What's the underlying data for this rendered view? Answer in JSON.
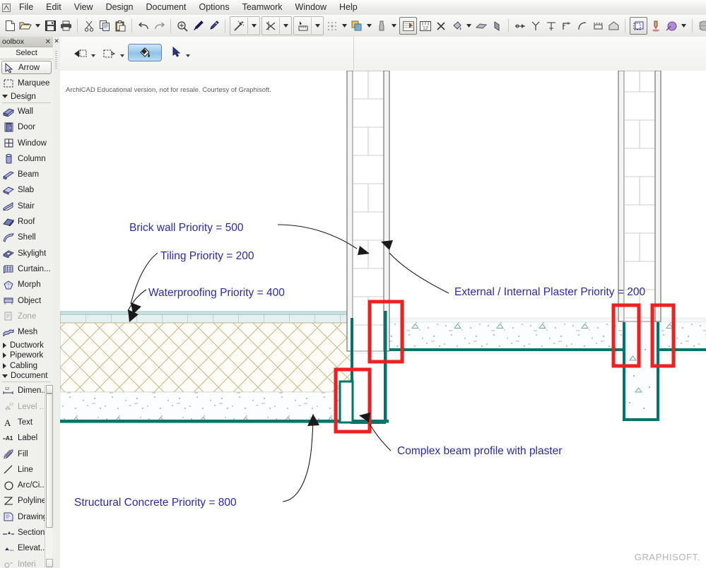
{
  "app": {
    "title": "ArchiCAD",
    "watermark": "GRAPHISOFT.",
    "edu_note": "ArchiCAD Educational version, not for resale. Courtesy of Graphisoft."
  },
  "menubar": {
    "logo_icon": "archicad-app-icon",
    "items": [
      {
        "label": "File"
      },
      {
        "label": "Edit"
      },
      {
        "label": "View"
      },
      {
        "label": "Design"
      },
      {
        "label": "Document"
      },
      {
        "label": "Options"
      },
      {
        "label": "Teamwork"
      },
      {
        "label": "Window"
      },
      {
        "label": "Help"
      }
    ]
  },
  "toolbar": {
    "items": [
      {
        "name": "new-file-icon",
        "kind": "icon"
      },
      {
        "name": "open-file-icon",
        "kind": "icon"
      },
      {
        "name": "open-file-dropdown",
        "kind": "caret"
      },
      {
        "name": "save-icon",
        "kind": "icon"
      },
      {
        "name": "print-icon",
        "kind": "icon"
      },
      {
        "name": "separator",
        "kind": "sep"
      },
      {
        "name": "cut-icon",
        "kind": "icon"
      },
      {
        "name": "copy-icon",
        "kind": "icon"
      },
      {
        "name": "paste-icon",
        "kind": "icon"
      },
      {
        "name": "separator",
        "kind": "sep"
      },
      {
        "name": "undo-icon",
        "kind": "icon"
      },
      {
        "name": "redo-icon",
        "kind": "icon"
      },
      {
        "name": "separator",
        "kind": "sep"
      },
      {
        "name": "zoom-window-icon",
        "kind": "icon"
      },
      {
        "name": "eyedropper-pick-icon",
        "kind": "icon"
      },
      {
        "name": "eyedropper-inject-icon",
        "kind": "icon"
      },
      {
        "name": "separator",
        "kind": "sep"
      },
      {
        "name": "magic-wand-icon",
        "kind": "group-icon"
      },
      {
        "name": "magic-wand-dropdown",
        "kind": "group-caret"
      },
      {
        "name": "trim-icon",
        "kind": "group-icon"
      },
      {
        "name": "trim-dropdown",
        "kind": "group-caret"
      },
      {
        "name": "measure-icon",
        "kind": "group-icon"
      },
      {
        "name": "measure-dropdown",
        "kind": "group-caret"
      },
      {
        "name": "grid-snap-icon",
        "kind": "icon"
      },
      {
        "name": "grid-snap-dropdown",
        "kind": "caret"
      },
      {
        "name": "layers-icon",
        "kind": "icon"
      },
      {
        "name": "layers-dropdown",
        "kind": "caret"
      },
      {
        "name": "pen-weight-icon",
        "kind": "icon"
      },
      {
        "name": "pen-weight-dropdown",
        "kind": "caret"
      },
      {
        "name": "build-material-icon",
        "kind": "boxed"
      },
      {
        "name": "dimension-settings-icon",
        "kind": "icon"
      },
      {
        "name": "scissors-icon",
        "kind": "icon"
      },
      {
        "name": "fill-pour-icon",
        "kind": "icon"
      },
      {
        "name": "fill-pour-dropdown",
        "kind": "caret"
      },
      {
        "name": "surface-paint-icon",
        "kind": "icon"
      },
      {
        "name": "surface-flip-icon",
        "kind": "icon"
      },
      {
        "name": "separator",
        "kind": "sep"
      },
      {
        "name": "connect-icon",
        "kind": "icon"
      },
      {
        "name": "split-icon",
        "kind": "icon"
      },
      {
        "name": "adjust-icon",
        "kind": "icon"
      },
      {
        "name": "intersect-icon",
        "kind": "icon"
      },
      {
        "name": "curve-fillet-icon",
        "kind": "icon"
      },
      {
        "name": "offset-icon",
        "kind": "icon"
      },
      {
        "name": "solid-ops-icon",
        "kind": "icon"
      },
      {
        "name": "separator",
        "kind": "sep"
      },
      {
        "name": "marquee-3d-icon",
        "kind": "boxed"
      },
      {
        "name": "3d-cutaway-icon",
        "kind": "icon"
      },
      {
        "name": "renovation-icon",
        "kind": "icon"
      },
      {
        "name": "renovation-dropdown",
        "kind": "caret"
      },
      {
        "name": "separator",
        "kind": "sep"
      },
      {
        "name": "globe-icon",
        "kind": "icon"
      }
    ]
  },
  "optionsbar": {
    "items": [
      {
        "name": "tool-pointer-settings-icon"
      },
      {
        "name": "marquee-settings-icon"
      },
      {
        "name": "fill-pour-active-icon"
      },
      {
        "name": "arrow-select-icon"
      }
    ]
  },
  "toolbox": {
    "panel_title": "oolbox",
    "close_icon": "close-icon",
    "select_group": "Select",
    "selected_tool": {
      "label": "Arrow",
      "icon": "arrow-cursor-icon"
    },
    "items": [
      {
        "label": "Marquee",
        "icon": "marquee-icon",
        "type": "tool"
      },
      {
        "label": "Design",
        "icon": "chevron-down-icon",
        "type": "category"
      },
      {
        "label": "Wall",
        "icon": "wall-icon",
        "type": "tool"
      },
      {
        "label": "Door",
        "icon": "door-icon",
        "type": "tool"
      },
      {
        "label": "Window",
        "icon": "window-icon",
        "type": "tool"
      },
      {
        "label": "Column",
        "icon": "column-icon",
        "type": "tool"
      },
      {
        "label": "Beam",
        "icon": "beam-icon",
        "type": "tool"
      },
      {
        "label": "Slab",
        "icon": "slab-icon",
        "type": "tool"
      },
      {
        "label": "Stair",
        "icon": "stair-icon",
        "type": "tool"
      },
      {
        "label": "Roof",
        "icon": "roof-icon",
        "type": "tool"
      },
      {
        "label": "Shell",
        "icon": "shell-icon",
        "type": "tool"
      },
      {
        "label": "Skylight",
        "icon": "skylight-icon",
        "type": "tool"
      },
      {
        "label": "Curtain...",
        "icon": "curtain-wall-icon",
        "type": "tool"
      },
      {
        "label": "Morph",
        "icon": "morph-icon",
        "type": "tool"
      },
      {
        "label": "Object",
        "icon": "object-icon",
        "type": "tool"
      },
      {
        "label": "Zone",
        "icon": "zone-icon",
        "type": "tool",
        "disabled": true
      },
      {
        "label": "Mesh",
        "icon": "mesh-icon",
        "type": "tool"
      },
      {
        "label": "Ductwork",
        "icon": "chevron-right-icon",
        "type": "category"
      },
      {
        "label": "Pipework",
        "icon": "chevron-right-icon",
        "type": "category"
      },
      {
        "label": "Cabling",
        "icon": "chevron-right-icon",
        "type": "category"
      },
      {
        "label": "Document",
        "icon": "chevron-down-icon",
        "type": "category"
      },
      {
        "label": "Dimen...",
        "icon": "dimension-icon",
        "type": "tool"
      },
      {
        "label": "Level ...",
        "icon": "level-dimension-icon",
        "type": "tool",
        "disabled": true
      },
      {
        "label": "Text",
        "icon": "text-icon",
        "type": "tool"
      },
      {
        "label": "Label",
        "icon": "label-icon",
        "type": "tool"
      },
      {
        "label": "Fill",
        "icon": "fill-icon",
        "type": "tool"
      },
      {
        "label": "Line",
        "icon": "line-icon",
        "type": "tool"
      },
      {
        "label": "Arc/Ci...",
        "icon": "arc-circle-icon",
        "type": "tool"
      },
      {
        "label": "Polyline",
        "icon": "polyline-icon",
        "type": "tool"
      },
      {
        "label": "Drawing",
        "icon": "drawing-icon",
        "type": "tool"
      },
      {
        "label": "Section",
        "icon": "section-icon",
        "type": "tool"
      },
      {
        "label": "Elevat...",
        "icon": "elevation-icon",
        "type": "tool"
      },
      {
        "label": "Interi",
        "icon": "interior-elevation-icon",
        "type": "tool",
        "disabled": true
      }
    ],
    "scrollbar": {
      "name": "toolbox-scrollbar"
    }
  },
  "annotations": [
    {
      "id": "brick",
      "text": "Brick wall Priority = 500"
    },
    {
      "id": "tiling",
      "text": "Tiling Priority = 200"
    },
    {
      "id": "waterproof",
      "text": "Waterproofing Priority = 400"
    },
    {
      "id": "plaster",
      "text": "External / Internal Plaster Priority = 200"
    },
    {
      "id": "beamprofile",
      "text": "Complex beam profile with plaster"
    },
    {
      "id": "concrete",
      "text": "Structural Concrete Priority = 800"
    }
  ],
  "colors": {
    "annotation_text": "#2b2b9e",
    "highlight_box": "#ee2020",
    "structure_line": "#00756c",
    "brick_hatch": "#c9b98a",
    "tile_fill": "#e2f0ef",
    "concrete_stipple": "#6fa8a4",
    "canvas_bg": "#ffffff"
  },
  "drawing": {
    "title": "Building section detail with composite priorities",
    "highlight_boxes": 4,
    "walls": 2
  }
}
